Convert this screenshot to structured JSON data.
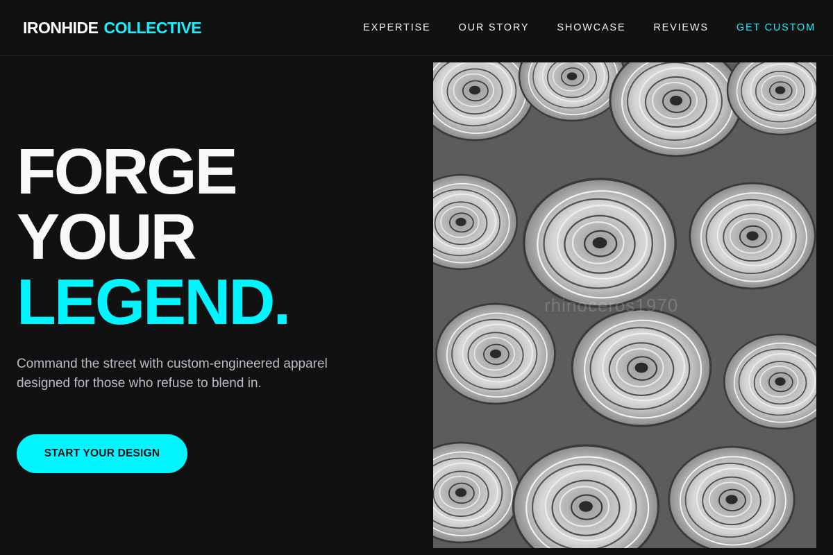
{
  "brand": {
    "part1": "IRONHIDE",
    "part2": "COLLECTIVE"
  },
  "nav": {
    "items": [
      {
        "label": "EXPERTISE"
      },
      {
        "label": "OUR STORY"
      },
      {
        "label": "SHOWCASE"
      },
      {
        "label": "REVIEWS"
      },
      {
        "label": "GET CUSTOM"
      }
    ]
  },
  "hero": {
    "line1": "FORGE",
    "line2": "YOUR",
    "line3": "LEGEND.",
    "description": "Command the street with custom-engineered apparel designed for those who refuse to blend in.",
    "cta_label": "START YOUR DESIGN"
  },
  "image": {
    "subject": "black-and-white photo of rolled fabric bolts",
    "watermark": "rhinoceros1970"
  },
  "colors": {
    "accent": "#00f5ff",
    "background": "#111112",
    "text_muted": "#b7bec8"
  }
}
